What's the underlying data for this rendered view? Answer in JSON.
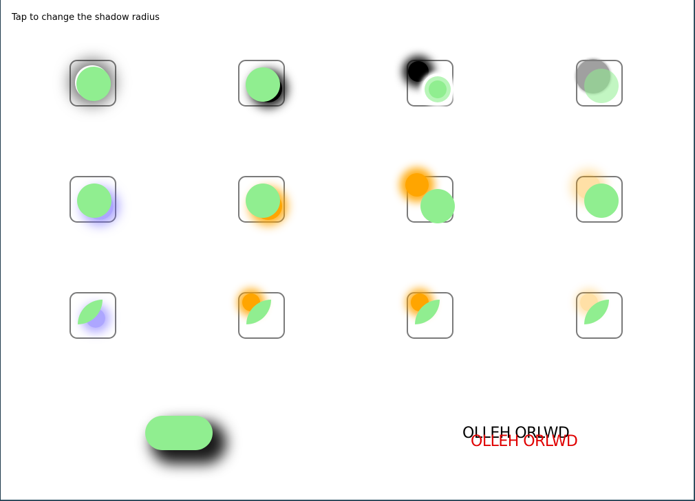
{
  "instruction": "Tap to change the shadow radius",
  "text_shadow_demo": {
    "black_text": "OLLEH ORLWD",
    "red_text": "OLLEH ORLWD"
  },
  "colors": {
    "shape_fill": "#90ee90",
    "shadow_black": "#000000",
    "shadow_gray": "#808080",
    "shadow_blue": "#6a5cff",
    "shadow_orange": "#ffa500",
    "text_red": "#e00000",
    "tile_border": "#7a7a7a"
  }
}
